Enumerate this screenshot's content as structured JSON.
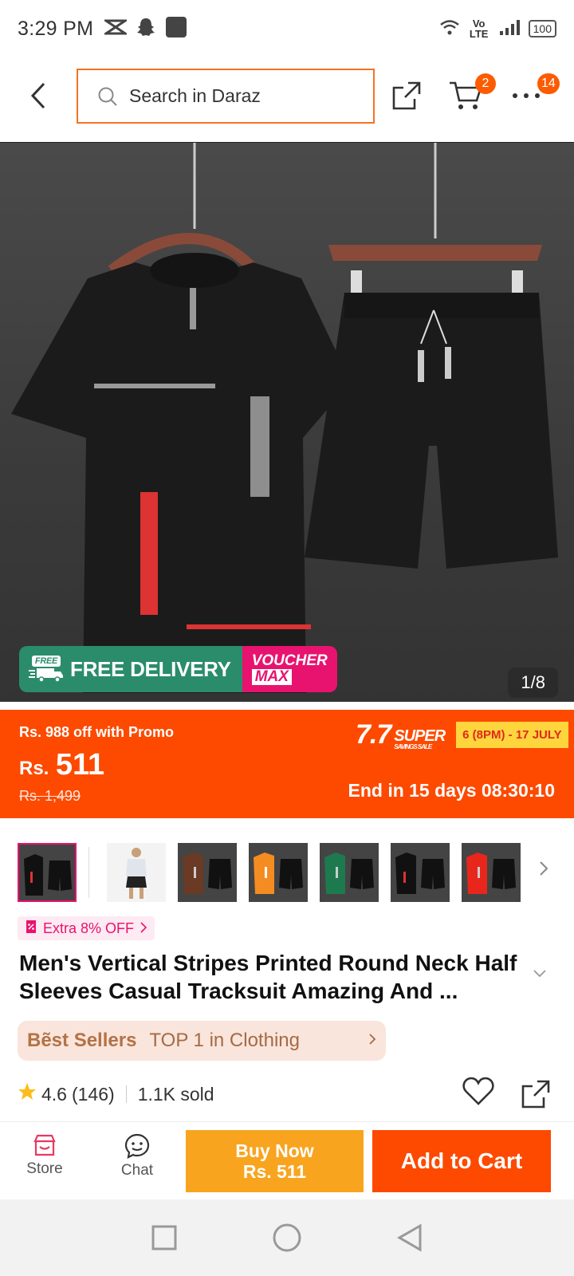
{
  "status_bar": {
    "time": "3:29 PM",
    "network": "Vo LTE",
    "battery": "100"
  },
  "header": {
    "search_placeholder": "Search in Daraz",
    "cart_count": "2",
    "menu_count": "14"
  },
  "gallery": {
    "banner_free": "FREE",
    "banner_delivery": "FREE DELIVERY",
    "banner_voucher_1": "VOUCHER",
    "banner_voucher_2": "MAX",
    "counter": "1/8",
    "thumbnail_count": 7
  },
  "price": {
    "promo_text": "Rs. 988 off with Promo",
    "currency": "Rs.",
    "amount": "511",
    "original": "Rs. 1,499",
    "campaign_main": "7.7",
    "campaign_sub": "SUPER",
    "campaign_tag": "SAVINGS SALE",
    "campaign_dates": "6 (8PM) - 17 JULY",
    "ends_in": "End in 15 days 08:30:10"
  },
  "product": {
    "extra_off": "Extra 8% OFF",
    "title": "Men's Vertical Stripes Printed Round Neck Half Sleeves Casual Tracksuit Amazing And ...",
    "best_sellers": "Bẽst Sellers",
    "rank": "TOP 1 in Clothing",
    "rating": "4.6",
    "reviews": "(146)",
    "sold": "1.1K sold"
  },
  "actions": {
    "store": "Store",
    "chat": "Chat",
    "buy_now": "Buy Now",
    "buy_price": "Rs. 511",
    "add_to_cart": "Add to Cart"
  },
  "colors": {
    "accent": "#fd4a00",
    "buy": "#f9a41f",
    "pink": "#e8136f",
    "green": "#2a8c6b"
  }
}
